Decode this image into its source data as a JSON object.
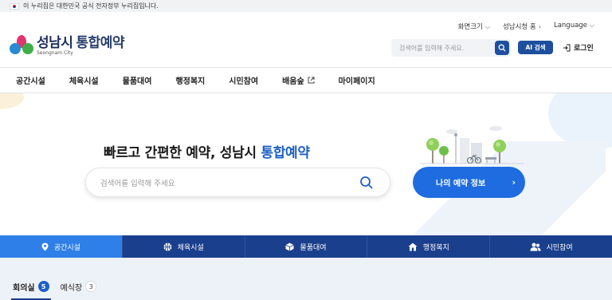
{
  "gov_banner": {
    "text": "이 누리집은 대한민국 공식 전자정부 누리집입니다."
  },
  "utility": {
    "font_size": "화면크기",
    "home": "성남시청 홈",
    "language": "Language"
  },
  "logo": {
    "name": "성남시",
    "service": "통합예약",
    "english": "Seongnam City"
  },
  "header": {
    "search_placeholder": "검색어를 입력해 주세요.",
    "ai_button": "AI 검색",
    "login": "로그인"
  },
  "nav": {
    "items": [
      {
        "label": "공간시설"
      },
      {
        "label": "체육시설"
      },
      {
        "label": "물품대여"
      },
      {
        "label": "행정복지"
      },
      {
        "label": "시민참여"
      },
      {
        "label": "배움숲",
        "external": true
      },
      {
        "label": "마이페이지"
      }
    ]
  },
  "hero": {
    "headline_plain": "빠르고 간편한 예약, 성남시 ",
    "headline_highlight": "통합예약",
    "search_placeholder": "검색어를 입력해 주세요",
    "my_button": "나의 예약 정보"
  },
  "categories": [
    {
      "label": "공간시설",
      "icon": "location-pin-icon",
      "active": true
    },
    {
      "label": "체육시설",
      "icon": "ball-icon",
      "active": false
    },
    {
      "label": "물품대여",
      "icon": "box-icon",
      "active": false
    },
    {
      "label": "행정복지",
      "icon": "house-icon",
      "active": false
    },
    {
      "label": "시민참여",
      "icon": "people-icon",
      "active": false
    }
  ],
  "sub_tabs": [
    {
      "label": "회의실",
      "count": "5",
      "active": true
    },
    {
      "label": "예식장",
      "count": "3",
      "active": false
    }
  ],
  "colors": {
    "primary": "#1a3f8c",
    "accent": "#1f6ce0",
    "active_tab": "#2f7fe8"
  }
}
